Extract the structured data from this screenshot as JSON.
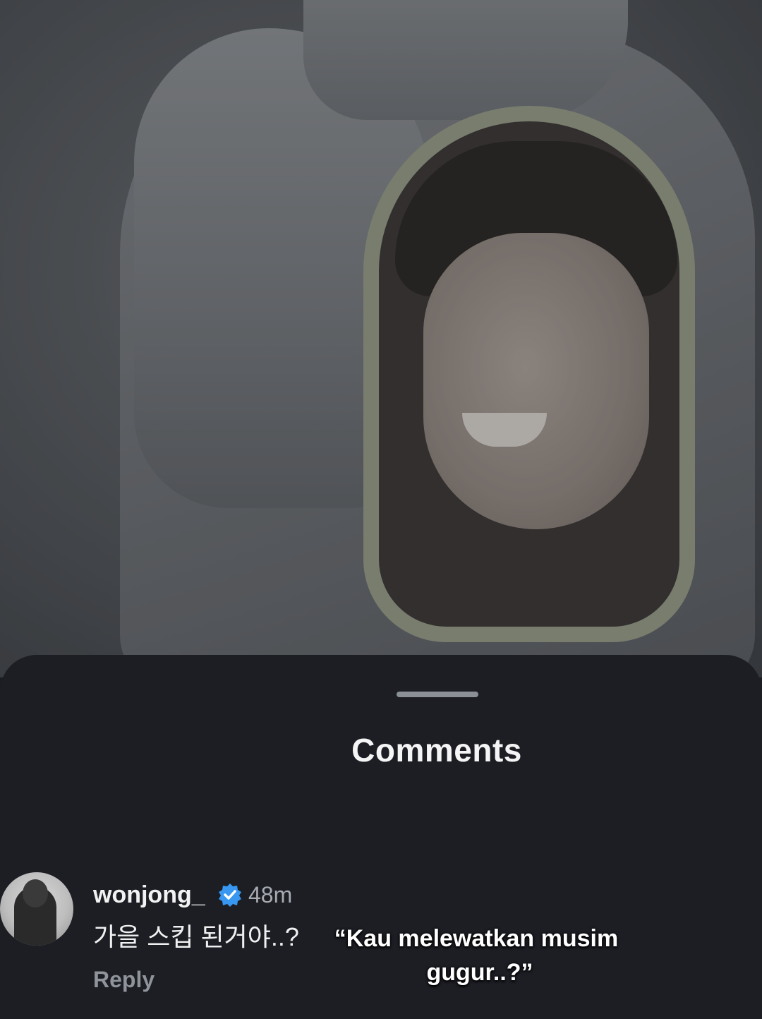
{
  "sheet": {
    "title": "Comments"
  },
  "comment": {
    "username": "wonjong_",
    "verified_icon": "verified-badge-icon",
    "time": "48m",
    "text": "가을 스킵 된거야..?",
    "translation_line1": "“Kau melewatkan musim",
    "translation_line2": "gugur..?”",
    "reply_label": "Reply"
  },
  "colors": {
    "sheet_bg": "#1c1e24",
    "verified": "#3897f0",
    "reply": "#8f939a"
  }
}
